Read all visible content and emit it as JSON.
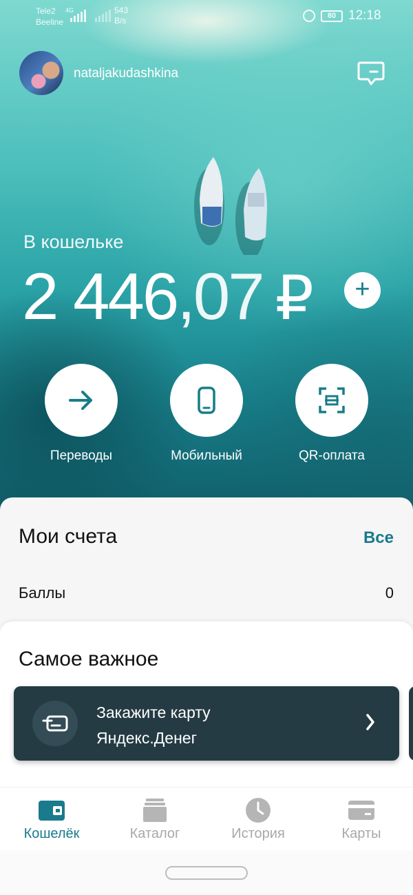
{
  "status_bar": {
    "carrier_1": "Tele2",
    "carrier_2": "Beeline",
    "network_type": "4G",
    "speed_value": "543",
    "speed_unit": "B/s",
    "battery": "80",
    "time": "12:18"
  },
  "header": {
    "username": "nataljakudashkina"
  },
  "wallet": {
    "label": "В кошельке",
    "balance_integer": "2 446",
    "balance_decimal": ",07",
    "currency": "₽",
    "add_symbol": "+"
  },
  "actions": [
    {
      "label": "Переводы",
      "icon": "arrow-right-icon"
    },
    {
      "label": "Мобильный",
      "icon": "phone-icon"
    },
    {
      "label": "QR-оплата",
      "icon": "qr-scan-icon"
    }
  ],
  "accounts": {
    "title": "Мои счета",
    "all_link": "Все",
    "points_label": "Баллы",
    "points_value": "0"
  },
  "important": {
    "title": "Самое важное",
    "promo_line1": "Закажите карту",
    "promo_line2": "Яндекс.Денег"
  },
  "tabs": [
    {
      "label": "Кошелёк",
      "icon": "wallet-icon",
      "active": true
    },
    {
      "label": "Каталог",
      "icon": "catalog-icon",
      "active": false
    },
    {
      "label": "История",
      "icon": "clock-icon",
      "active": false
    },
    {
      "label": "Карты",
      "icon": "card-icon",
      "active": false
    }
  ],
  "colors": {
    "accent": "#1a7a8e",
    "promo_bg": "#253b44",
    "inactive_tab": "#a8a8a8"
  }
}
